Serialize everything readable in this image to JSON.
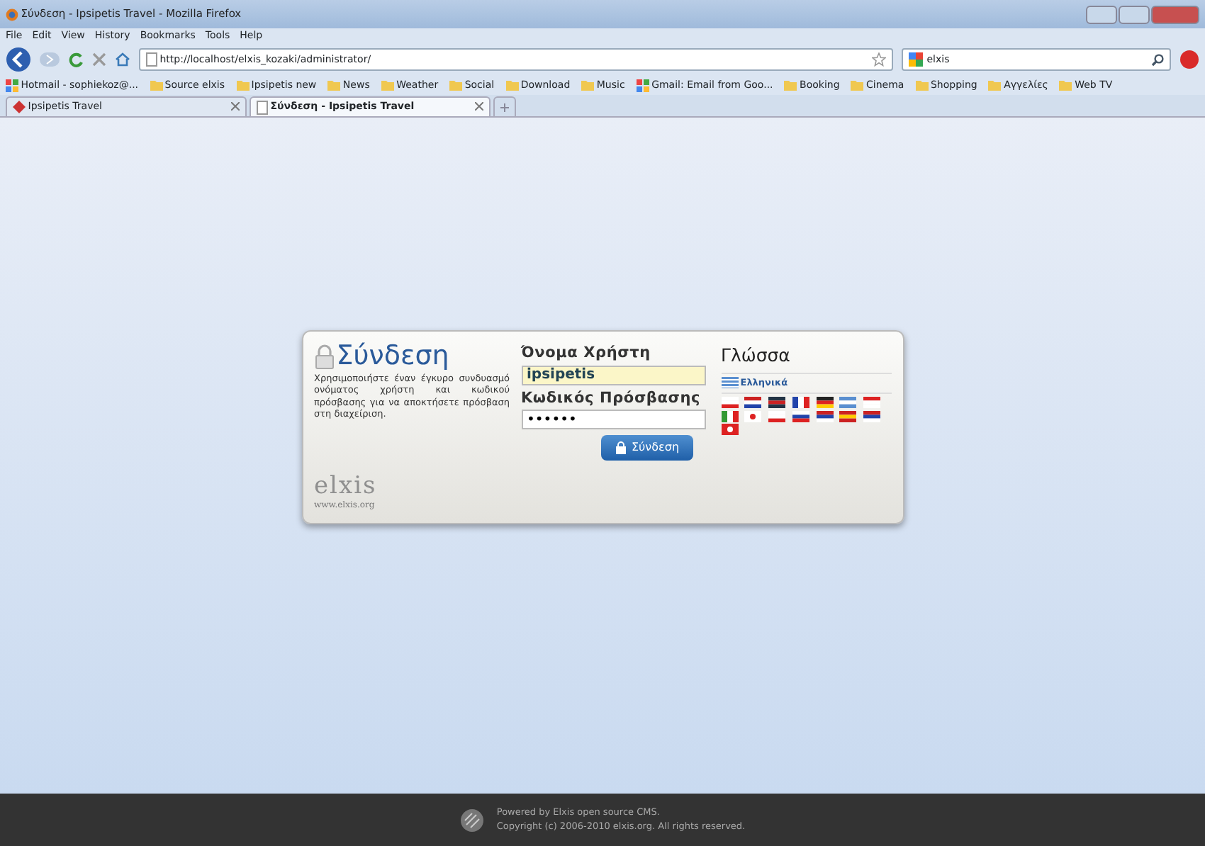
{
  "window": {
    "title": "Σύνδεση - Ipsipetis Travel - Mozilla Firefox"
  },
  "menu": [
    "File",
    "Edit",
    "View",
    "History",
    "Bookmarks",
    "Tools",
    "Help"
  ],
  "address": "http://localhost/elxis_kozaki/administrator/",
  "search": "elxis",
  "bookmarks": [
    {
      "label": "Hotmail - sophiekoz@...",
      "kind": "site"
    },
    {
      "label": "Source elxis",
      "kind": "folder"
    },
    {
      "label": "Ipsipetis new",
      "kind": "folder"
    },
    {
      "label": "News",
      "kind": "folder"
    },
    {
      "label": "Weather",
      "kind": "folder"
    },
    {
      "label": "Social",
      "kind": "folder"
    },
    {
      "label": "Download",
      "kind": "folder"
    },
    {
      "label": "Music",
      "kind": "folder"
    },
    {
      "label": "Gmail: Email from Goo...",
      "kind": "site"
    },
    {
      "label": "Booking",
      "kind": "folder"
    },
    {
      "label": "Cinema",
      "kind": "folder"
    },
    {
      "label": "Shopping",
      "kind": "folder"
    },
    {
      "label": "Αγγελίες",
      "kind": "folder"
    },
    {
      "label": "Web TV",
      "kind": "folder"
    }
  ],
  "tabs": [
    {
      "label": "Ipsipetis Travel",
      "selected": false
    },
    {
      "label": "Σύνδεση - Ipsipetis Travel",
      "selected": true
    }
  ],
  "login": {
    "title": "Σύνδεση",
    "description": "Χρησιμοποιήστε έναν έγκυρο συνδυασμό ονόματος χρήστη και κωδικού πρόσβασης για να αποκτήσετε πρόσβαση στη διαχείριση.",
    "logo": "elxis",
    "logo_url": "www.elxis.org",
    "username_label": "Όνομα Χρήστη",
    "username": "ipsipetis",
    "password_label": "Κωδικός Πρόσβασης",
    "password": "••••••",
    "button": "Σύνδεση",
    "language_title": "Γλώσσα",
    "current_language": "Ελληνικά"
  },
  "footer": {
    "line_1": "Powered by Elxis open source CMS.",
    "line_2": "Copyright (c) 2006-2010 elxis.org. All rights reserved."
  }
}
